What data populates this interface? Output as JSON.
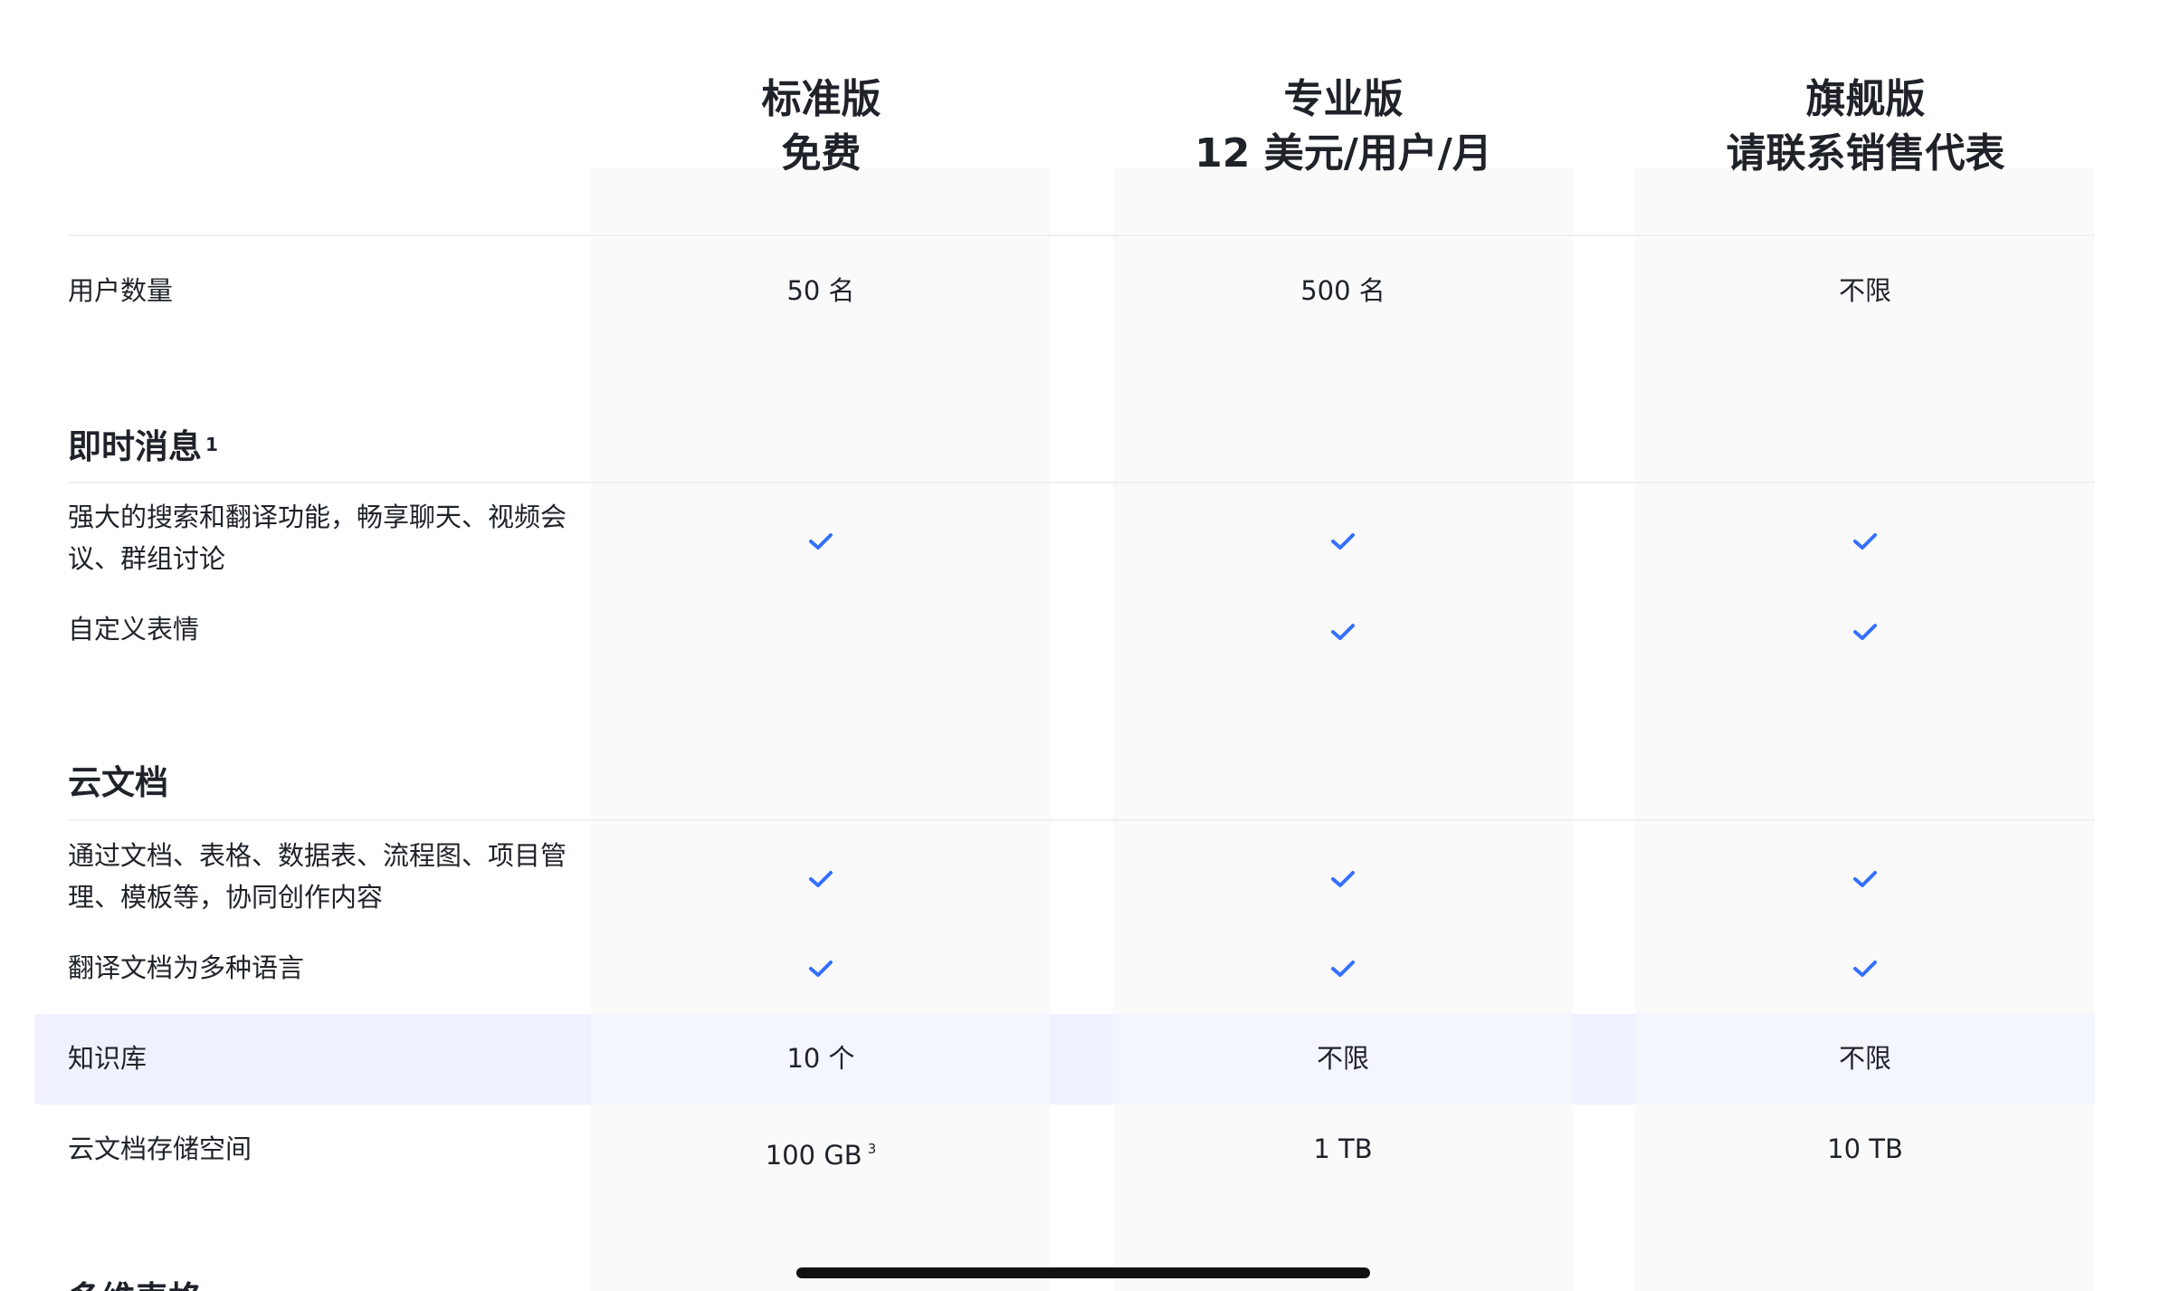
{
  "plans": [
    {
      "name": "标准版",
      "price": "免费"
    },
    {
      "name": "专业版",
      "price": "12 美元/用户/月"
    },
    {
      "name": "旗舰版",
      "price": "请联系销售代表"
    }
  ],
  "rows": {
    "users": {
      "label": "用户数量",
      "values": [
        "50 名",
        "500 名",
        "不限"
      ]
    },
    "im_title": {
      "label": "即时消息",
      "sup": "1"
    },
    "im_search": {
      "label": "强大的搜索和翻译功能，畅享聊天、视频会议、群组讨论"
    },
    "im_emoji": {
      "label": "自定义表情"
    },
    "docs_title": {
      "label": "云文档"
    },
    "docs_collab": {
      "label": "通过文档、表格、数据表、流程图、项目管理、模板等，协同创作内容"
    },
    "docs_translate": {
      "label": "翻译文档为多种语言"
    },
    "wiki": {
      "label": "知识库",
      "values": [
        "10 个",
        "不限",
        "不限"
      ]
    },
    "storage": {
      "label": "云文档存储空间",
      "values": [
        "100 GB",
        "1 TB",
        "10 TB"
      ],
      "sup": "3"
    },
    "next_title": {
      "label": "多维表格"
    }
  },
  "colors": {
    "check": "#3370ff",
    "highlight": "#eff2fe",
    "column_panel": "#fafafb"
  },
  "icons": {
    "feature_included": "checkmark-icon"
  }
}
